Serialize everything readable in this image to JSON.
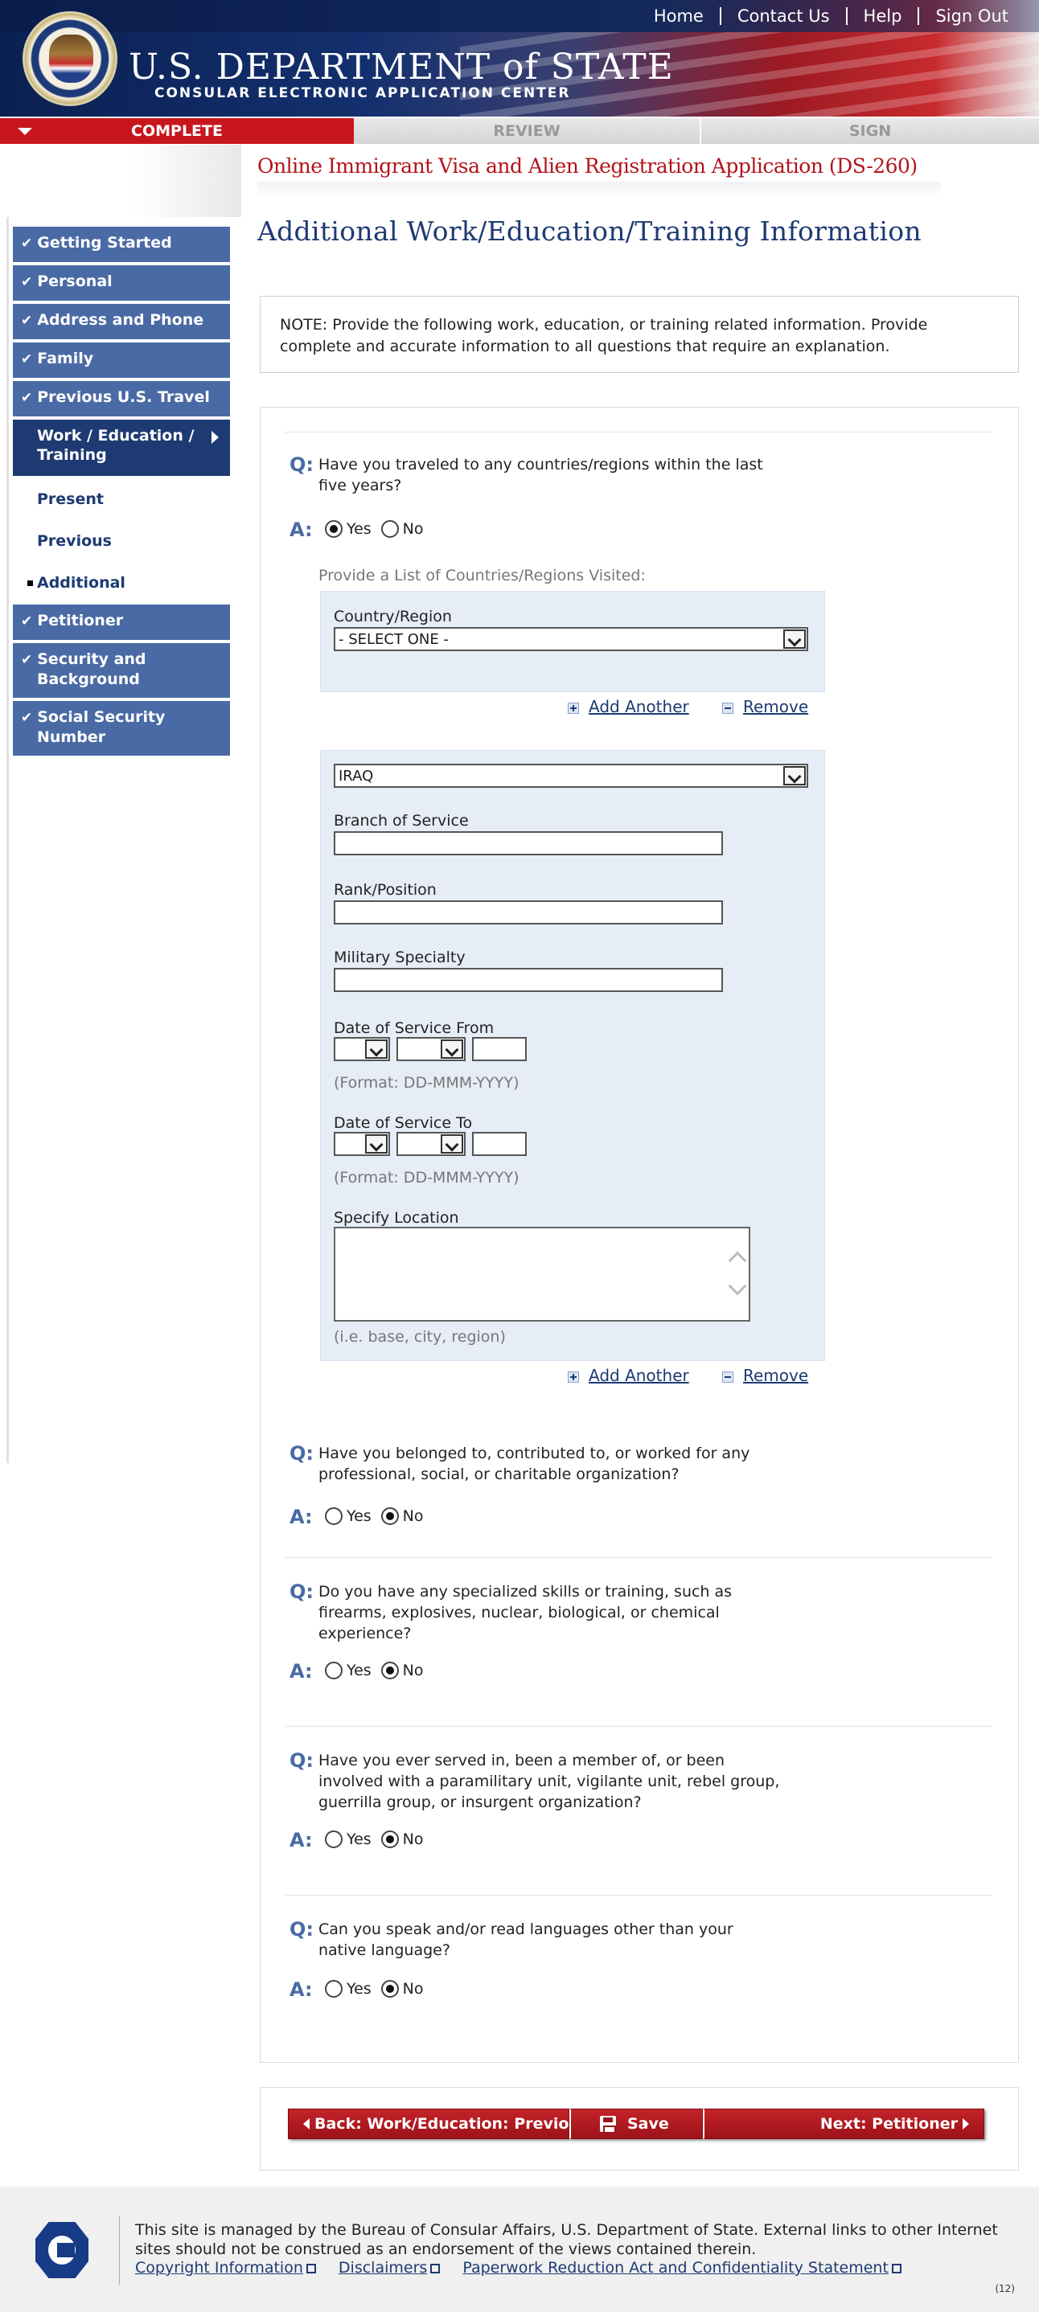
{
  "header": {
    "links": [
      "Home",
      "Contact Us",
      "Help",
      "Sign Out"
    ],
    "title": "U.S. DEPARTMENT of STATE",
    "subtitle": "CONSULAR ELECTRONIC APPLICATION CENTER"
  },
  "progress": {
    "complete": "COMPLETE",
    "review": "REVIEW",
    "sign": "SIGN"
  },
  "nav": {
    "items": [
      {
        "label": "Getting Started"
      },
      {
        "label": "Personal"
      },
      {
        "label": "Address and Phone"
      },
      {
        "label": "Family"
      },
      {
        "label": "Previous U.S. Travel"
      }
    ],
    "current": "Work / Education / Training",
    "subs": [
      "Present",
      "Previous",
      "Additional"
    ],
    "after": [
      {
        "label": "Petitioner"
      },
      {
        "label": "Security and Background"
      },
      {
        "label": "Social Security Number"
      }
    ]
  },
  "app_title": "Online Immigrant Visa and Alien Registration Application (DS-260)",
  "page_title": "Additional Work/Education/Training Information",
  "note": "NOTE: Provide the following work, education, or training related information. Provide complete and accurate information to all questions that require an explanation.",
  "labels": {
    "q": "Q:",
    "a": "A:",
    "yes": "Yes",
    "no": "No"
  },
  "questions": [
    {
      "text": "Have you traveled to any countries/regions within the last five years?",
      "answer": "Yes"
    },
    {
      "text": "Have you belonged to, contributed to, or worked for any professional, social, or charitable organization?",
      "answer": "No"
    },
    {
      "text": "Do you have any specialized skills or training, such as firearms, explosives, nuclear, biological, or chemical experience?",
      "answer": "No"
    },
    {
      "text": "Have you ever served in, been a member of, or been involved with a paramilitary unit, vigilante unit, rebel group, guerrilla group, or insurgent organization?",
      "answer": "No"
    },
    {
      "text": "Can you speak and/or read languages other than your native language?",
      "answer": "No"
    }
  ],
  "countries": {
    "prompt": "Provide a List of Countries/Regions Visited:",
    "field_label": "Country/Region",
    "selected": "- SELECT ONE -"
  },
  "military": {
    "country_selected": "IRAQ",
    "branch_label": "Branch of Service",
    "rank_label": "Rank/Position",
    "specialty_label": "Military Specialty",
    "from_label": "Date of Service From",
    "to_label": "Date of Service To",
    "date_format": "(Format: DD-MMM-YYYY)",
    "location_label": "Specify Location",
    "location_hint": "(i.e. base, city, region)"
  },
  "actions": {
    "add": "Add Another",
    "remove": "Remove"
  },
  "buttons": {
    "back": "Back: Work/Education: Previous",
    "save": "Save",
    "next": "Next: Petitioner"
  },
  "footer": {
    "text": "This site is managed by the Bureau of Consular Affairs, U.S. Department of State. External links to other Internet sites should not be construed as an endorsement of the views contained therein.",
    "links": [
      "Copyright Information",
      "Disclaimers",
      "Paperwork Reduction Act and Confidentiality Statement"
    ],
    "page_num": "(12)"
  }
}
